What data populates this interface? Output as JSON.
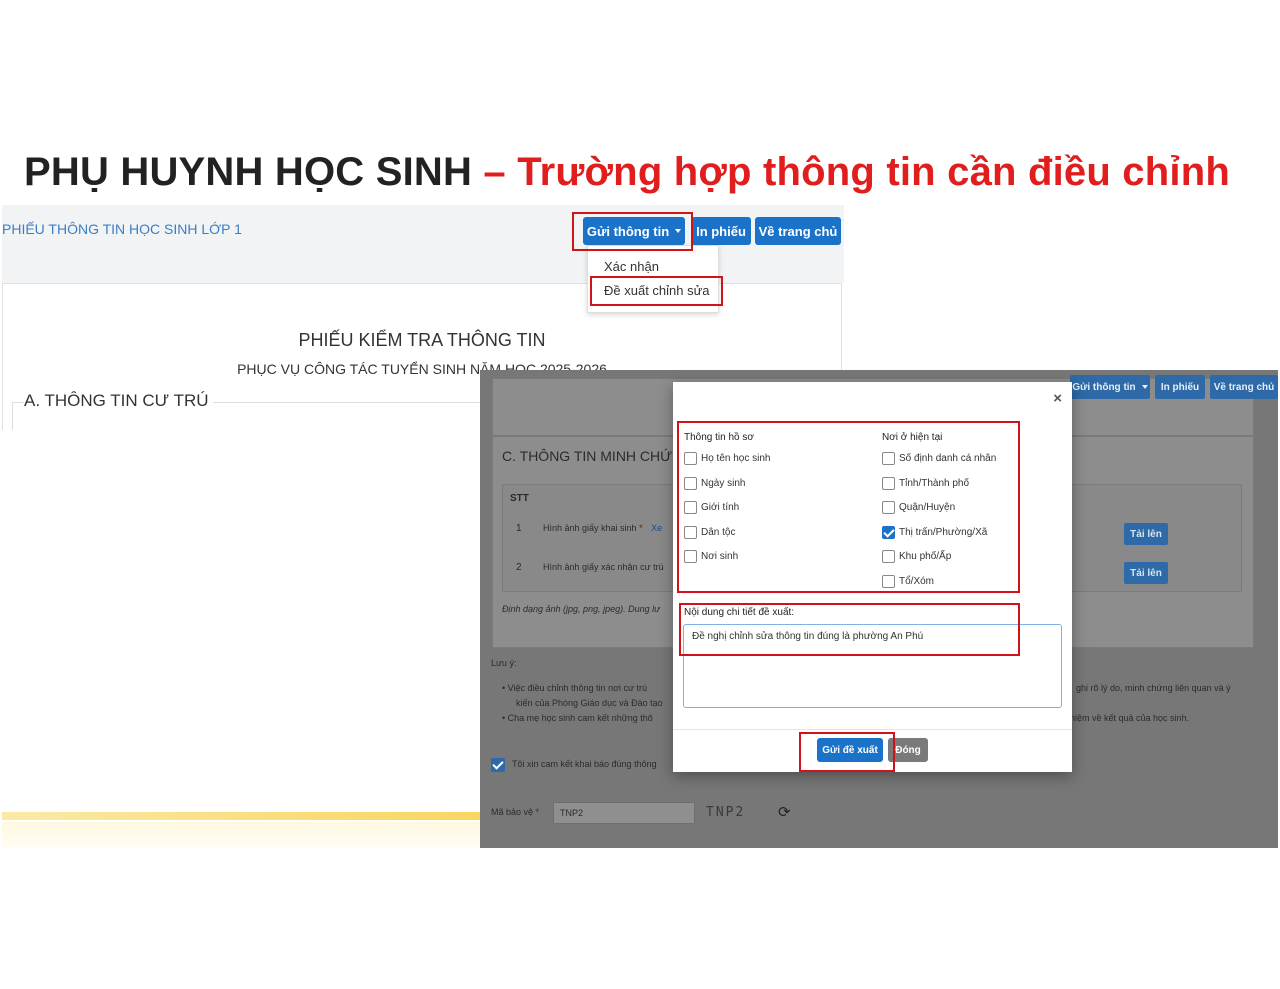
{
  "heading": {
    "black": "PHỤ HUYNH HỌC SINH",
    "dash": "–",
    "red": "Trường hợp thông tin cần điều chỉnh"
  },
  "shot1": {
    "breadcrumb": "PHIẾU THÔNG TIN HỌC SINH LỚP 1",
    "send_button": "Gửi thông tin",
    "print_button": "In phiếu",
    "home_button": "Về trang chủ",
    "menu": [
      "Xác nhận",
      "Đề xuất chỉnh sửa"
    ],
    "form_title": "PHIẾU KIỂM TRA THÔNG TIN",
    "form_subtitle": "PHỤC VỤ CÔNG TÁC TUYỂN SINH NĂM HỌC 2025-2026",
    "section_a": "A. THÔNG TIN CƯ TRÚ"
  },
  "shot2": {
    "send_button": "Gửi thông tin",
    "print_button": "In phiếu",
    "home_button": "Về trang chủ",
    "section_c": "C. THÔNG TIN MINH CHỨ",
    "table_header_stt": "STT",
    "rows": [
      {
        "stt": "1",
        "label": "Hình ảnh giấy khai sinh",
        "required": "*",
        "link": "Xe",
        "action": "Tải lên"
      },
      {
        "stt": "2",
        "label": "Hình ảnh giấy xác nhận cư trú",
        "action": "Tải lên"
      }
    ],
    "format_note": "Định dạng ảnh (jpg, png, jpeg). Dung lư",
    "note_label": "Lưu ý:",
    "bullets": [
      {
        "left": "Việc điều chỉnh thông tin nơi cư trú",
        "right": "ghi rõ lý do, minh chứng liên quan và ý"
      },
      {
        "left": "kiến của Phòng Giáo dục và Đào tạo"
      },
      {
        "left": "Cha mẹ học sinh cam kết những thô",
        "right": "hiệm về kết quả của học sinh."
      }
    ],
    "commit_text": "Tôi xin cam kết khai báo đúng thông",
    "captcha_label": "Mã bảo vệ",
    "captcha_required": "*",
    "captcha_value": "TNP2",
    "captcha_image_text": "TNP2"
  },
  "modal": {
    "close": "×",
    "col1_title": "Thông tin hồ sơ",
    "col1_items": [
      {
        "label": "Họ tên học sinh",
        "checked": false
      },
      {
        "label": "Ngày sinh",
        "checked": false
      },
      {
        "label": "Giới tính",
        "checked": false
      },
      {
        "label": "Dân tộc",
        "checked": false
      },
      {
        "label": "Nơi sinh",
        "checked": false
      }
    ],
    "col2_title": "Nơi ở hiện tại",
    "col2_items": [
      {
        "label": "Số định danh cá nhân",
        "checked": false
      },
      {
        "label": "Tỉnh/Thành phố",
        "checked": false
      },
      {
        "label": "Quận/Huyện",
        "checked": false
      },
      {
        "label": "Thị trấn/Phường/Xã",
        "checked": true
      },
      {
        "label": "Khu phố/Ấp",
        "checked": false
      },
      {
        "label": "Tổ/Xóm",
        "checked": false
      }
    ],
    "detail_label": "Nội dung chi tiết đề xuất:",
    "detail_value": "Đề nghị chỉnh sửa thông tin đúng là phường An Phú",
    "submit_button": "Gửi đề xuất",
    "close_button": "Đóng"
  },
  "colors": {
    "accent": "#1a73c9",
    "highlight": "#d0121b",
    "title_red": "#e01e1e"
  }
}
